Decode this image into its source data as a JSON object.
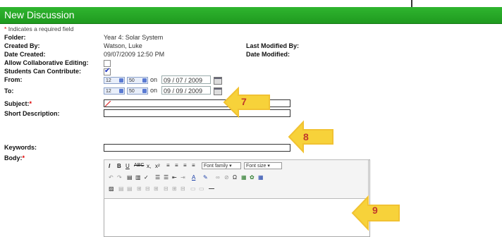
{
  "window": {
    "title": "New Discussion"
  },
  "form": {
    "required_note": "Indicates a required field",
    "folder_label": "Folder:",
    "folder_value": "Year 4: Solar System",
    "created_by_label": "Created By:",
    "created_by_value": "Watson, Luke",
    "last_modified_by_label": "Last Modified By:",
    "date_created_label": "Date Created:",
    "date_created_value": "09/07/2009 12:50 PM",
    "date_modified_label": "Date Modified:",
    "collab_label": "Allow Collaborative Editing:",
    "collab_checked": false,
    "contribute_label": "Students Can Contribute:",
    "contribute_checked": true,
    "from_label": "From:",
    "from_hour": "12",
    "from_minute": "50",
    "from_on": "on",
    "from_date": "09 / 07 / 2009",
    "to_label": "To:",
    "to_hour": "12",
    "to_minute": "50",
    "to_on": "on",
    "to_date": "09 / 09 / 2009",
    "subject_label": "Subject:",
    "short_desc_label": "Short Description:",
    "keywords_label": "Keywords:",
    "body_label": "Body:"
  },
  "editor": {
    "font_family": "Font family",
    "font_size": "Font size"
  },
  "callouts": [
    "7",
    "8",
    "9"
  ],
  "colors": {
    "header": "#1f9a1f",
    "callout": "#f7d23a",
    "callout_text": "#c0392b"
  }
}
